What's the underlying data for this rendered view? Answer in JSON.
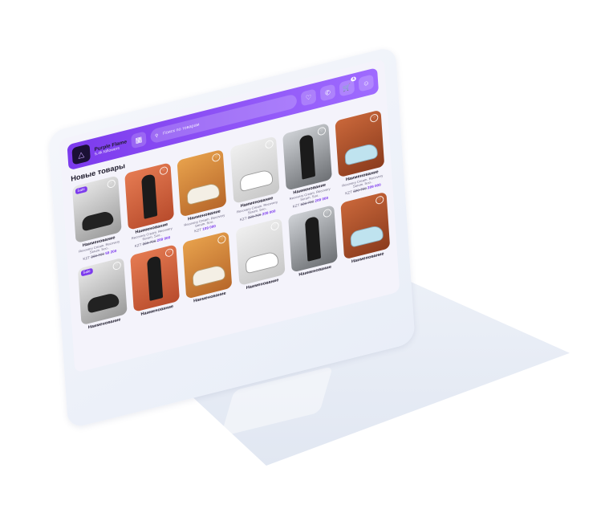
{
  "store": {
    "name": "Purple Flame",
    "followers": "5.4k followers"
  },
  "search": {
    "placeholder": "Поиск по товарам"
  },
  "header": {
    "cart_badge": "4"
  },
  "section_title": "Новые товары",
  "products": [
    {
      "name": "Наименование",
      "desc": "Recovery Cream. Recovery Serum. Soo..",
      "currency": "KZT",
      "old": "300 700",
      "new": "59 200",
      "sale": "Sale"
    },
    {
      "name": "Наименование",
      "desc": "Recovery Cream. Recovery Serum. Soo..",
      "currency": "KZT",
      "old": "330 700",
      "new": "209 000",
      "sale": ""
    },
    {
      "name": "Наименование",
      "desc": "Recovery Cream. Recovery Serum. Soo..",
      "currency": "KZT",
      "old": "",
      "new": "109 000",
      "sale": ""
    },
    {
      "name": "Наименование",
      "desc": "Recovery Cream. Recovery Serum. Soo..",
      "currency": "KZT",
      "old": "320 700",
      "new": "209 000",
      "sale": ""
    },
    {
      "name": "Наименование",
      "desc": "Recovery Cream. Recovery Serum. Soo..",
      "currency": "KZT",
      "old": "330 700",
      "new": "209 000",
      "sale": ""
    },
    {
      "name": "Наименование",
      "desc": "Recovery Cream. Recovery Serum. Soo..",
      "currency": "KZT",
      "old": "320 700",
      "new": "209 000",
      "sale": ""
    }
  ],
  "products_row2": [
    {
      "name": "Наименование",
      "sale": "Sale"
    },
    {
      "name": "Наименование",
      "sale": ""
    },
    {
      "name": "Наименование",
      "sale": ""
    },
    {
      "name": "Наименование",
      "sale": ""
    },
    {
      "name": "Наименование",
      "sale": ""
    },
    {
      "name": "Наименование",
      "sale": ""
    }
  ],
  "colors": {
    "accent": "#7c3aed",
    "accent_light": "#9f6bff"
  }
}
